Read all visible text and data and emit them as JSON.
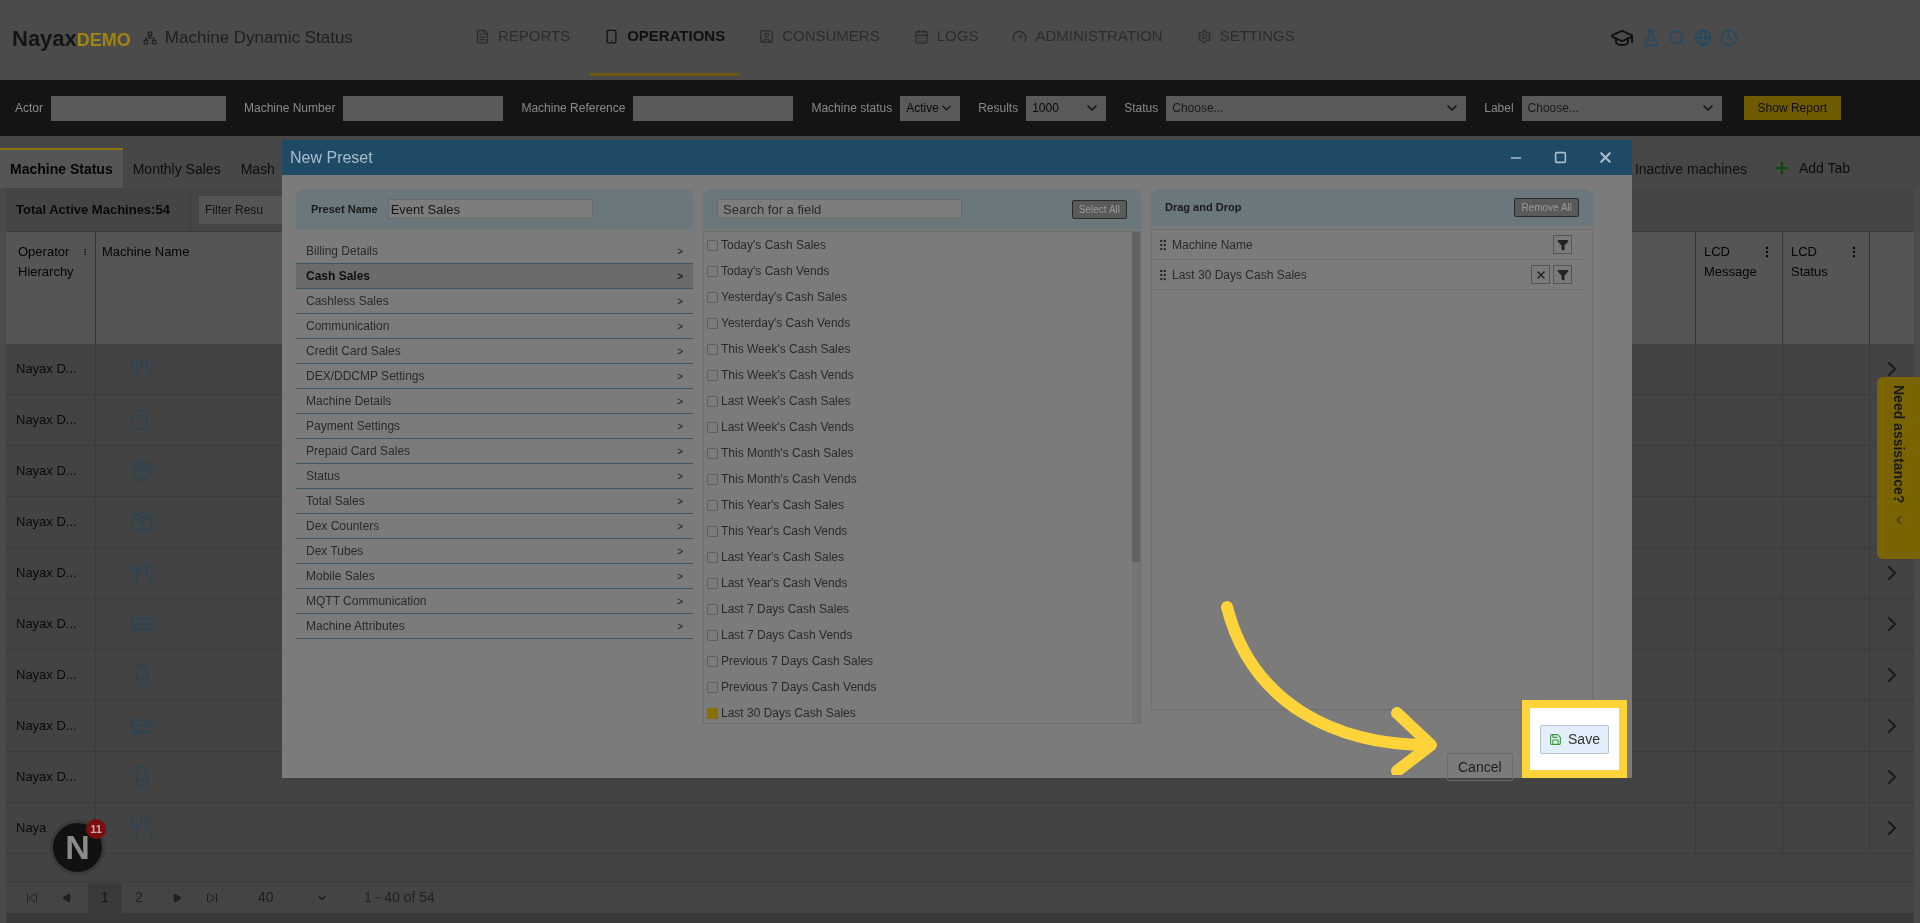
{
  "header": {
    "logo": {
      "name": "Nayax",
      "badge": "DEMO"
    },
    "page_title": "Machine Dynamic Status",
    "nav": [
      {
        "label": "REPORTS",
        "selected": false
      },
      {
        "label": "OPERATIONS",
        "selected": true
      },
      {
        "label": "CONSUMERS",
        "selected": false
      },
      {
        "label": "LOGS",
        "selected": false
      },
      {
        "label": "ADMINISTRATION",
        "selected": false
      },
      {
        "label": "SETTINGS",
        "selected": false
      }
    ]
  },
  "filters": [
    {
      "label": "Actor",
      "kind": "text"
    },
    {
      "label": "Machine Number",
      "kind": "text"
    },
    {
      "label": "Machine Reference",
      "kind": "text"
    },
    {
      "label": "Machine status",
      "kind": "select",
      "value": "Active"
    },
    {
      "label": "Results",
      "kind": "select",
      "value": "1000"
    },
    {
      "label": "Status",
      "kind": "select",
      "placeholder": "Choose..."
    },
    {
      "label": "Label",
      "kind": "select",
      "placeholder": "Choose..."
    }
  ],
  "show_report": "Show Report",
  "tabs": [
    {
      "label": "Machine Status",
      "selected": true
    },
    {
      "label": "Monthly Sales",
      "selected": false
    },
    {
      "label": "Mash",
      "selected": false
    },
    {
      "label": "Inactive machines",
      "selected": false
    }
  ],
  "add_tab": "Add Tab",
  "toolbar": {
    "total": "Total Active Machines:54",
    "filter_placeholder": "Filter Resu"
  },
  "table": {
    "left_columns": [
      "Operator Hierarchy",
      "Machine Name"
    ],
    "right_columns": [
      "LCD Message",
      "LCD Status"
    ],
    "rows": [
      {
        "operator": "Nayax D...",
        "kind": "utensils"
      },
      {
        "operator": "Nayax D...",
        "kind": "cup"
      },
      {
        "operator": "Nayax D...",
        "kind": "snack"
      },
      {
        "operator": "Nayax D...",
        "kind": "snack"
      },
      {
        "operator": "Nayax D...",
        "kind": "utensils"
      },
      {
        "operator": "Nayax D...",
        "kind": "bus"
      },
      {
        "operator": "Nayax D...",
        "kind": "bottle"
      },
      {
        "operator": "Nayax D...",
        "kind": "bus"
      },
      {
        "operator": "Nayax D...",
        "kind": "bottle"
      },
      {
        "operator": "Naya",
        "kind": "utensils"
      }
    ]
  },
  "pagination": {
    "pages": [
      {
        "label": "1",
        "selected": true
      },
      {
        "label": "2",
        "selected": false
      }
    ],
    "page_size": "40",
    "range": "1 - 40 of 54"
  },
  "help_tab": "Need assistance?",
  "assistant": {
    "letter": "N",
    "count": "11"
  },
  "dialog": {
    "title": "New Preset",
    "preset_label": "Preset Name",
    "preset_value": "Event Sales",
    "categories": [
      {
        "label": "Billing Details",
        "selected": false
      },
      {
        "label": "Cash Sales",
        "selected": true
      },
      {
        "label": "Cashless Sales",
        "selected": false
      },
      {
        "label": "Communication",
        "selected": false
      },
      {
        "label": "Credit Card Sales",
        "selected": false
      },
      {
        "label": "DEX/DDCMP Settings",
        "selected": false
      },
      {
        "label": "Machine Details",
        "selected": false
      },
      {
        "label": "Payment Settings",
        "selected": false
      },
      {
        "label": "Prepaid Card Sales",
        "selected": false
      },
      {
        "label": "Status",
        "selected": false
      },
      {
        "label": "Total Sales",
        "selected": false
      },
      {
        "label": "Dex Counters",
        "selected": false
      },
      {
        "label": "Dex Tubes",
        "selected": false
      },
      {
        "label": "Mobile Sales",
        "selected": false
      },
      {
        "label": "MQTT Communication",
        "selected": false
      },
      {
        "label": "Machine Attributes",
        "selected": false
      }
    ],
    "category_arrow": ">",
    "search_placeholder": "Search for a field",
    "select_all": "Select All",
    "fields": [
      {
        "label": "Today's Cash Sales",
        "checked": false
      },
      {
        "label": "Today's Cash Vends",
        "checked": false
      },
      {
        "label": "Yesterday's Cash Sales",
        "checked": false
      },
      {
        "label": "Yesterday's Cash Vends",
        "checked": false
      },
      {
        "label": "This Week's Cash Sales",
        "checked": false
      },
      {
        "label": "This Week's Cash Vends",
        "checked": false
      },
      {
        "label": "Last Week's Cash Sales",
        "checked": false
      },
      {
        "label": "Last Week's Cash Vends",
        "checked": false
      },
      {
        "label": "This Month's Cash Sales",
        "checked": false
      },
      {
        "label": "This Month's Cash Vends",
        "checked": false
      },
      {
        "label": "This Year's Cash Sales",
        "checked": false
      },
      {
        "label": "This Year's Cash Vends",
        "checked": false
      },
      {
        "label": "Last Year's Cash Sales",
        "checked": false
      },
      {
        "label": "Last Year's Cash Vends",
        "checked": false
      },
      {
        "label": "Last 7 Days Cash Sales",
        "checked": false
      },
      {
        "label": "Last 7 Days Cash Vends",
        "checked": false
      },
      {
        "label": "Previous 7 Days Cash Sales",
        "checked": false
      },
      {
        "label": "Previous 7 Days Cash Vends",
        "checked": false
      },
      {
        "label": "Last 30 Days Cash Sales",
        "checked": true
      }
    ],
    "dnd_title": "Drag and Drop",
    "remove_all": "Remove All",
    "chosen": [
      {
        "label": "Machine Name",
        "removable": false
      },
      {
        "label": "Last 30 Days Cash Sales",
        "removable": true
      }
    ],
    "cancel": "Cancel",
    "save": "Save"
  }
}
